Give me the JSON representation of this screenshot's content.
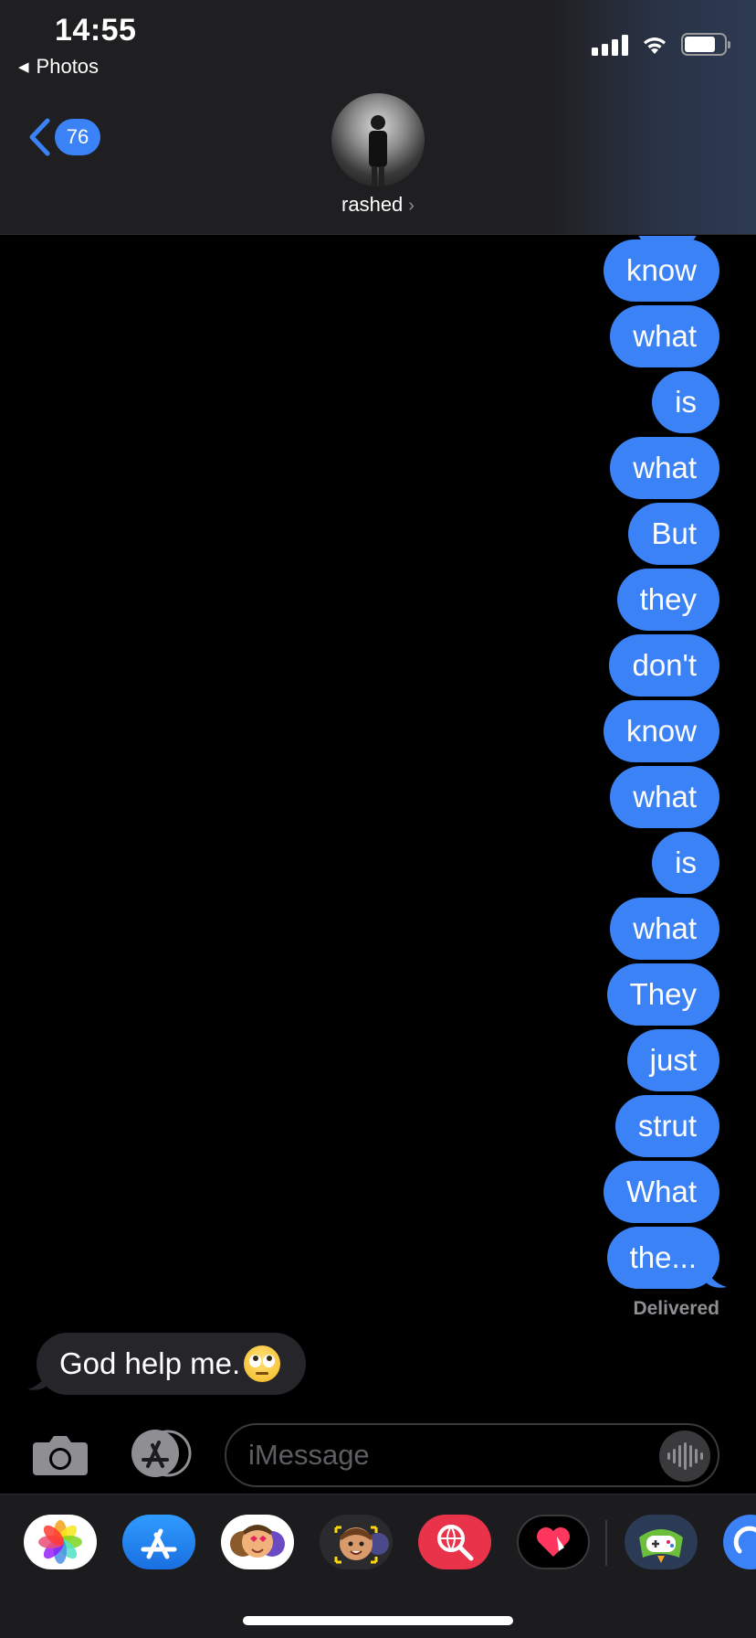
{
  "status_bar": {
    "time": "14:55",
    "back_app": "Photos",
    "icons": [
      "cellular-signal-icon",
      "wifi-icon",
      "battery-icon"
    ]
  },
  "nav": {
    "unread_count": "76",
    "contact_name": "rashed"
  },
  "colors": {
    "outgoing_bubble": "#3b82f6",
    "incoming_bubble": "#26252a",
    "background": "#000000",
    "header": "#1f1f21"
  },
  "messages": {
    "outgoing": [
      "know",
      "what",
      "is",
      "what",
      "But",
      "they",
      "don't",
      "know",
      "what",
      "is",
      "what",
      "They",
      "just",
      "strut",
      "What",
      "the..."
    ],
    "status": "Delivered",
    "incoming_text": "God help me.",
    "incoming_emoji": "eye-roll-emoji"
  },
  "compose": {
    "placeholder": "iMessage",
    "value": ""
  },
  "app_drawer": {
    "apps": [
      "photos-app-icon",
      "app-store-icon",
      "memoji-stickers-icon",
      "animoji-icon",
      "web-search-icon",
      "digital-touch-icon",
      "game-app-icon",
      "more-app-icon"
    ]
  }
}
